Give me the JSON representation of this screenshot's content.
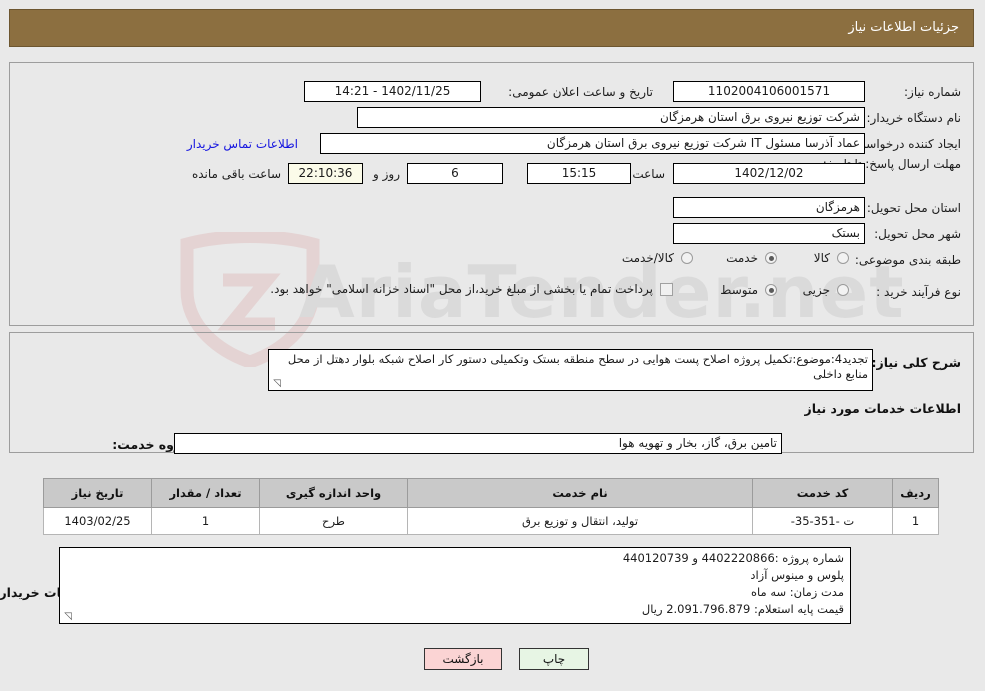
{
  "header": {
    "title": "جزئیات اطلاعات نیاز"
  },
  "form": {
    "need_number_label": "شماره نیاز:",
    "need_number_value": "1102004106001571",
    "announce_label": "تاریخ و ساعت اعلان عمومی:",
    "announce_value": "1402/11/25 - 14:21",
    "buyer_org_label": "نام دستگاه خریدار:",
    "buyer_org_value": "شرکت توزیع نیروی برق استان هرمزگان",
    "requester_label": "ایجاد کننده درخواست:",
    "requester_value": "عماد آذرسا مسئول IT شرکت توزیع نیروی برق استان هرمزگان",
    "contact_link": "اطلاعات تماس خریدار",
    "deadline_label": "مهلت ارسال پاسخ: تا تاریخ:",
    "deadline_date": "1402/12/02",
    "hour_label": "ساعت",
    "deadline_time": "15:15",
    "days_value": "6",
    "days_label": "روز و",
    "remaining_time": "22:10:36",
    "remaining_label": "ساعت باقی مانده",
    "province_label": "استان محل تحویل:",
    "province_value": "هرمزگان",
    "city_label": "شهر محل تحویل:",
    "city_value": "بستک",
    "category_label": "طبقه بندی موضوعی:",
    "category_options": [
      {
        "label": "کالا",
        "selected": false
      },
      {
        "label": "خدمت",
        "selected": true
      },
      {
        "label": "کالا/خدمت",
        "selected": false
      }
    ],
    "process_label": "نوع فرآیند خرید :",
    "process_options": [
      {
        "label": "جزیی",
        "selected": false
      },
      {
        "label": "متوسط",
        "selected": true
      }
    ],
    "treasury_checkbox_label": "پرداخت تمام یا بخشی از مبلغ خرید،از محل \"اسناد خزانه اسلامی\" خواهد بود.",
    "treasury_checked": false
  },
  "description": {
    "label": "شرح کلی نیاز:",
    "value": "تجدید4:موضوع:تکمیل پروژه اصلاح پست هوایی در سطح منطقه  بستک وتکمیلی دستور کار اصلاح شبکه بلوار دهتل از محل منابع داخلی"
  },
  "services": {
    "section_title": "اطلاعات خدمات مورد نیاز",
    "group_label": "گروه خدمت:",
    "group_value": "تامین برق، گاز، بخار و تهویه هوا",
    "table": {
      "columns": [
        "ردیف",
        "کد خدمت",
        "نام خدمت",
        "واحد اندازه گیری",
        "تعداد / مقدار",
        "تاریخ نیاز"
      ],
      "rows": [
        [
          "1",
          "ت -351-35-",
          "تولید، انتقال و توزیع برق",
          "طرح",
          "1",
          "1403/02/25"
        ]
      ]
    }
  },
  "notes": {
    "label": "توضیحات خریدار:",
    "lines": [
      "شماره پروژه :4402220866 و 440120739",
      "پلوس و مینوس آزاد",
      "مدت زمان:  سه ماه",
      "قیمت پایه استعلام:   2.091.796.879  ریال"
    ]
  },
  "footer": {
    "print_label": "چاپ",
    "back_label": "بازگشت"
  },
  "watermark": {
    "text": "AriaTender.net"
  },
  "colors": {
    "header_bar": "#8c6f40",
    "link": "#1414e0",
    "print_button": "#e7f5e4",
    "back_button": "#fbd4d4",
    "cream_field": "#fbfbe9",
    "table_header": "#c9c9c9"
  }
}
